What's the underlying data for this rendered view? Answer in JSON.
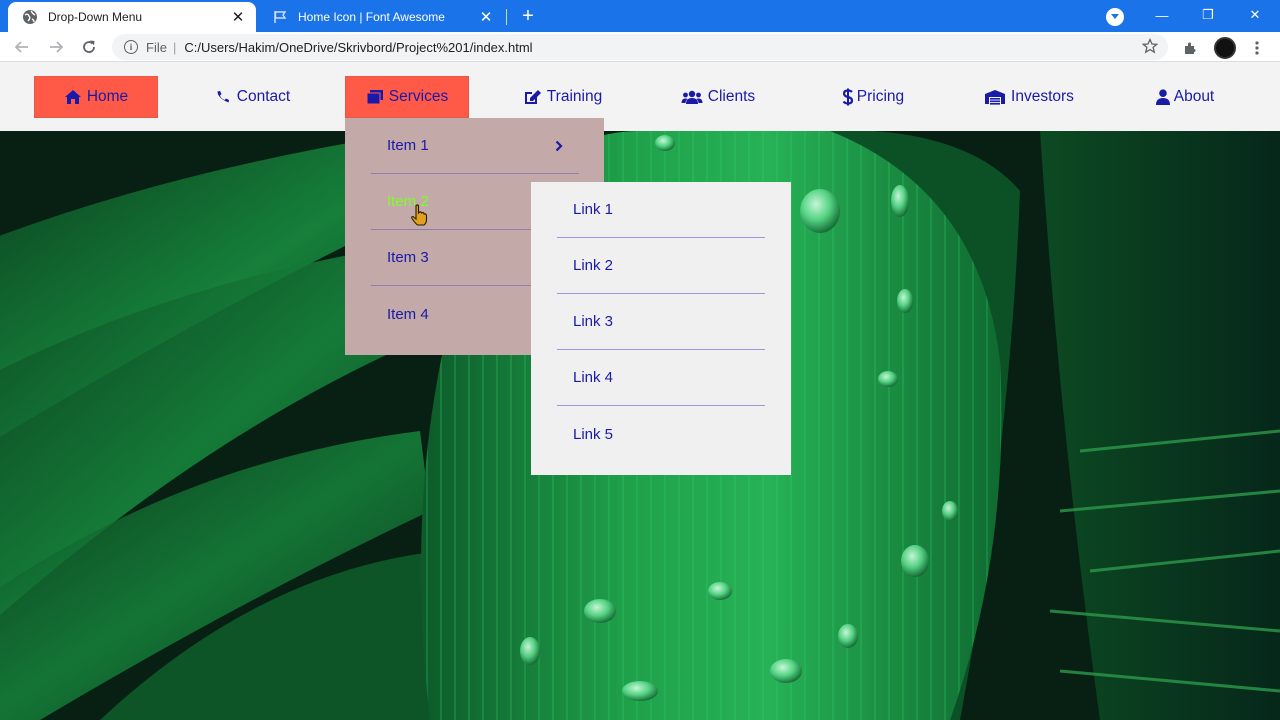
{
  "browser": {
    "tabs": [
      {
        "title": "Drop-Down Menu",
        "icon": "globe-icon",
        "active": true
      },
      {
        "title": "Home Icon | Font Awesome",
        "icon": "flag-icon",
        "active": false
      }
    ],
    "address": {
      "scheme": "File",
      "url": "C:/Users/Hakim/OneDrive/Skrivbord/Project%201/index.html"
    },
    "accent": "#1a73e8"
  },
  "nav": {
    "items": [
      {
        "label": "Home",
        "icon": "home-icon",
        "highlighted": true
      },
      {
        "label": "Contact",
        "icon": "phone-icon",
        "highlighted": false
      },
      {
        "label": "Services",
        "icon": "layers-icon",
        "highlighted": true
      },
      {
        "label": "Training",
        "icon": "edit-icon",
        "highlighted": false
      },
      {
        "label": "Clients",
        "icon": "users-icon",
        "highlighted": false
      },
      {
        "label": "Pricing",
        "icon": "dollar-icon",
        "highlighted": false
      },
      {
        "label": "Investors",
        "icon": "warehouse-icon",
        "highlighted": false
      },
      {
        "label": "About",
        "icon": "user-icon",
        "highlighted": false
      }
    ],
    "text_color": "#1a1aa8",
    "highlight_color": "#ff5a47"
  },
  "dropdown": {
    "items": [
      {
        "label": "Item 1",
        "has_submenu": true
      },
      {
        "label": "Item 2",
        "hovered": true
      },
      {
        "label": "Item 3"
      },
      {
        "label": "Item 4"
      }
    ],
    "background": "#c4a9a9",
    "hover_text_color": "#7dff28"
  },
  "submenu": {
    "items": [
      "Link 1",
      "Link 2",
      "Link 3",
      "Link 4",
      "Link 5"
    ],
    "background": "#f0f0f0"
  }
}
